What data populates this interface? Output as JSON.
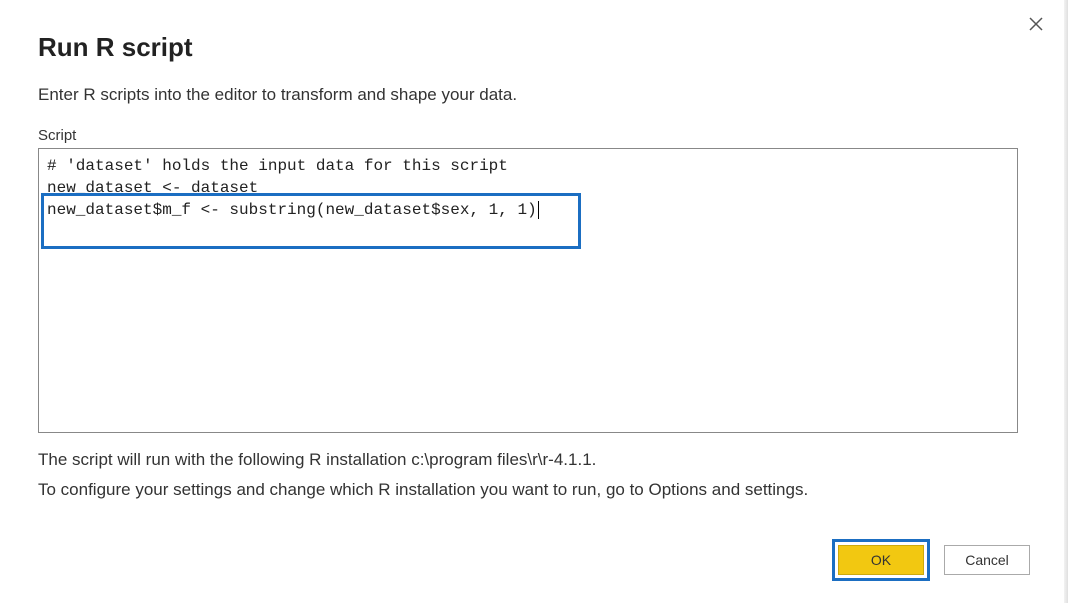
{
  "dialog": {
    "title": "Run R script",
    "subtitle": "Enter R scripts into the editor to transform and shape your data.",
    "close_icon": "close"
  },
  "script_field": {
    "label": "Script",
    "lines": {
      "l1": "# 'dataset' holds the input data for this script",
      "l2": "new_dataset <- dataset",
      "l3": "new_dataset$m_f <- substring(new_dataset$sex, 1, 1)"
    }
  },
  "info": {
    "line1": "The script will run with the following R installation c:\\program files\\r\\r-4.1.1.",
    "line2": "To configure your settings and change which R installation you want to run, go to Options and settings."
  },
  "buttons": {
    "ok": "OK",
    "cancel": "Cancel"
  },
  "colors": {
    "accent_highlight": "#1b6ec2",
    "ok_button_bg": "#f2c811"
  }
}
